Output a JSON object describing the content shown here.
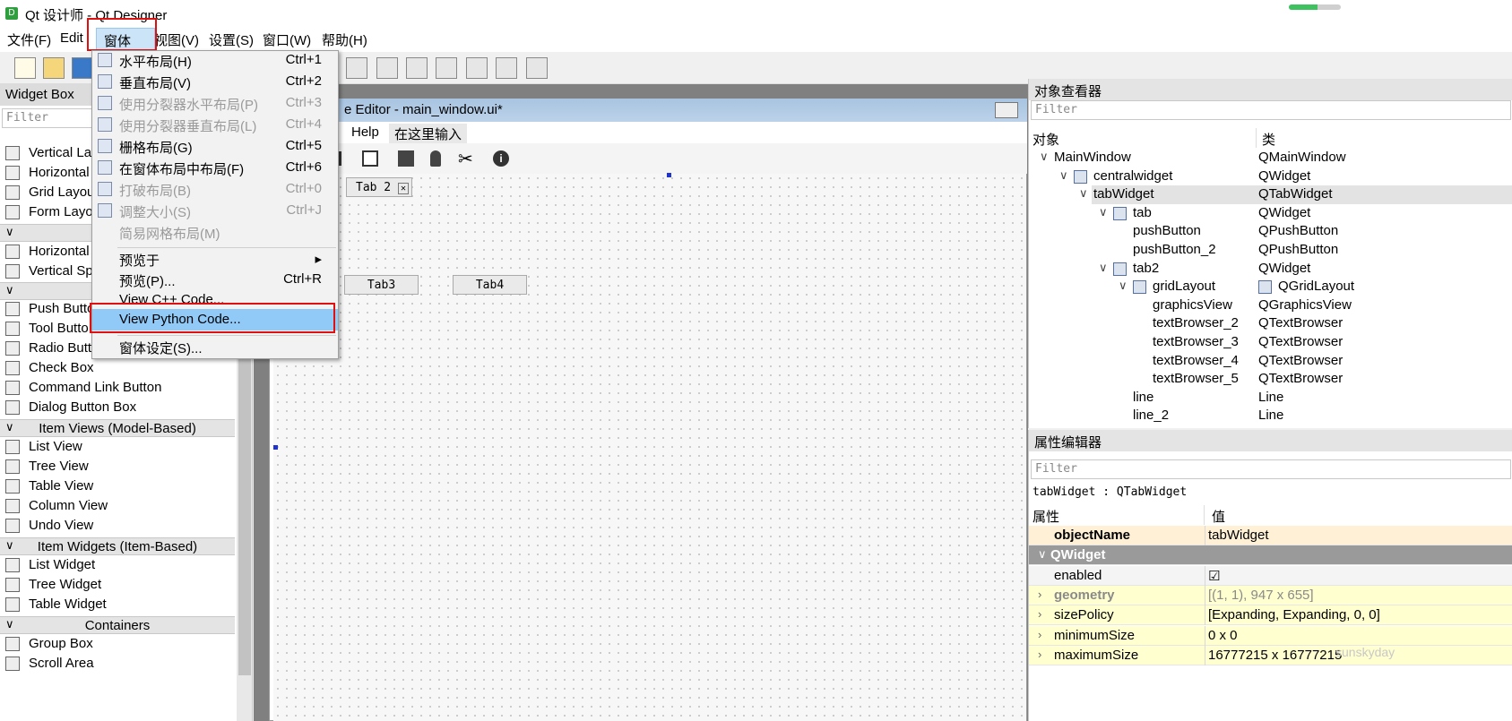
{
  "window": {
    "title": "Qt 设计师 - Qt Designer",
    "app_icon": "D"
  },
  "title_progress_fraction": 0.55,
  "menubar": [
    "文件(F)",
    "Edit",
    "窗体(O)",
    "视图(V)",
    "设置(S)",
    "窗口(W)",
    "帮助(H)"
  ],
  "popup_menu": [
    {
      "label": "水平布局(H)",
      "shortcut": "Ctrl+1",
      "disabled": false,
      "icon": "horizontal-layout-icon"
    },
    {
      "label": "垂直布局(V)",
      "shortcut": "Ctrl+2",
      "disabled": false,
      "icon": "vertical-layout-icon"
    },
    {
      "label": "使用分裂器水平布局(P)",
      "shortcut": "Ctrl+3",
      "disabled": true,
      "icon": "splitter-horizontal-icon"
    },
    {
      "label": "使用分裂器垂直布局(L)",
      "shortcut": "Ctrl+4",
      "disabled": true,
      "icon": "splitter-vertical-icon"
    },
    {
      "label": "栅格布局(G)",
      "shortcut": "Ctrl+5",
      "disabled": false,
      "icon": "grid-layout-icon"
    },
    {
      "label": "在窗体布局中布局(F)",
      "shortcut": "Ctrl+6",
      "disabled": false,
      "icon": "form-layout-icon"
    },
    {
      "label": "打破布局(B)",
      "shortcut": "Ctrl+0",
      "disabled": true,
      "icon": "break-layout-icon"
    },
    {
      "label": "调整大小(S)",
      "shortcut": "Ctrl+J",
      "disabled": true,
      "icon": "adjust-size-icon"
    },
    {
      "label": "简易网格布局(M)",
      "shortcut": "",
      "disabled": true,
      "icon": ""
    },
    {
      "label": "预览于",
      "shortcut": "▸",
      "disabled": false,
      "icon": ""
    },
    {
      "label": "预览(P)...",
      "shortcut": "Ctrl+R",
      "disabled": false,
      "icon": ""
    },
    {
      "label": "View C++ Code...",
      "shortcut": "",
      "disabled": false,
      "icon": ""
    },
    {
      "label": "View Python Code...",
      "shortcut": "",
      "disabled": false,
      "icon": ""
    },
    {
      "label": "窗体设定(S)...",
      "shortcut": "",
      "disabled": false,
      "icon": ""
    }
  ],
  "widget_box": {
    "header": "Widget Box",
    "filter_placeholder": "Filter",
    "items": [
      {
        "kind": "item",
        "label": "Vertical La",
        "icon": "vertical-layout-icon"
      },
      {
        "kind": "item",
        "label": "Horizontal",
        "icon": "horizontal-layout-icon"
      },
      {
        "kind": "item",
        "label": "Grid Layou",
        "icon": "grid-layout-icon"
      },
      {
        "kind": "item",
        "label": "Form Layo",
        "icon": "form-layout-icon"
      },
      {
        "kind": "cat",
        "label": ""
      },
      {
        "kind": "item",
        "label": "Horizontal",
        "icon": "horizontal-spacer-icon"
      },
      {
        "kind": "item",
        "label": "Vertical Sp",
        "icon": "vertical-spacer-icon"
      },
      {
        "kind": "cat",
        "label": ""
      },
      {
        "kind": "item",
        "label": "Push Butto",
        "icon": "push-button-icon"
      },
      {
        "kind": "item",
        "label": "Tool Butto",
        "icon": "tool-button-icon"
      },
      {
        "kind": "item",
        "label": "Radio Butt",
        "icon": "radio-button-icon"
      },
      {
        "kind": "item",
        "label": "Check Box",
        "icon": "check-box-icon"
      },
      {
        "kind": "item",
        "label": "Command Link Button",
        "icon": "command-link-icon"
      },
      {
        "kind": "item",
        "label": "Dialog Button Box",
        "icon": "dialog-button-box-icon"
      },
      {
        "kind": "cat",
        "label": "Item Views (Model-Based)"
      },
      {
        "kind": "item",
        "label": "List View",
        "icon": "list-view-icon"
      },
      {
        "kind": "item",
        "label": "Tree View",
        "icon": "tree-view-icon"
      },
      {
        "kind": "item",
        "label": "Table View",
        "icon": "table-view-icon"
      },
      {
        "kind": "item",
        "label": "Column View",
        "icon": "column-view-icon"
      },
      {
        "kind": "item",
        "label": "Undo View",
        "icon": "undo-view-icon"
      },
      {
        "kind": "cat",
        "label": "Item Widgets (Item-Based)"
      },
      {
        "kind": "item",
        "label": "List Widget",
        "icon": "list-widget-icon"
      },
      {
        "kind": "item",
        "label": "Tree Widget",
        "icon": "tree-widget-icon"
      },
      {
        "kind": "item",
        "label": "Table Widget",
        "icon": "table-widget-icon"
      },
      {
        "kind": "cat",
        "label": "Containers"
      },
      {
        "kind": "item",
        "label": "Group Box",
        "icon": "group-box-icon"
      },
      {
        "kind": "item",
        "label": "Scroll Area",
        "icon": "scroll-area-icon"
      }
    ]
  },
  "form": {
    "title": "e Editor - main_window.ui*",
    "menu": [
      "Help",
      "在这里输入"
    ],
    "tabs": [
      "Tab 2",
      "Tab3",
      "Tab4"
    ]
  },
  "object_inspector": {
    "header": "对象查看器",
    "filter_placeholder": "Filter",
    "col_object": "对象",
    "col_class": "类",
    "rows": [
      {
        "name": "MainWindow",
        "cls": "QMainWindow",
        "depth": 0,
        "arrow": "∨",
        "icon": "",
        "sel": false
      },
      {
        "name": "centralwidget",
        "cls": "QWidget",
        "depth": 1,
        "arrow": "∨",
        "icon": "vertical-layout-icon",
        "sel": false
      },
      {
        "name": "tabWidget",
        "cls": "QTabWidget",
        "depth": 2,
        "arrow": "∨",
        "icon": "",
        "sel": true
      },
      {
        "name": "tab",
        "cls": "QWidget",
        "depth": 3,
        "arrow": "∨",
        "icon": "broken-layout-icon",
        "sel": false
      },
      {
        "name": "pushButton",
        "cls": "QPushButton",
        "depth": 4,
        "arrow": "",
        "icon": "",
        "sel": false
      },
      {
        "name": "pushButton_2",
        "cls": "QPushButton",
        "depth": 4,
        "arrow": "",
        "icon": "",
        "sel": false
      },
      {
        "name": "tab2",
        "cls": "QWidget",
        "depth": 3,
        "arrow": "∨",
        "icon": "horizontal-layout-icon",
        "sel": false
      },
      {
        "name": "gridLayout",
        "cls": "QGridLayout",
        "depth": 4,
        "arrow": "∨",
        "icon": "grid-layout-icon",
        "sel": false
      },
      {
        "name": "graphicsView",
        "cls": "QGraphicsView",
        "depth": 5,
        "arrow": "",
        "icon": "",
        "sel": false
      },
      {
        "name": "textBrowser_2",
        "cls": "QTextBrowser",
        "depth": 5,
        "arrow": "",
        "icon": "",
        "sel": false
      },
      {
        "name": "textBrowser_3",
        "cls": "QTextBrowser",
        "depth": 5,
        "arrow": "",
        "icon": "",
        "sel": false
      },
      {
        "name": "textBrowser_4",
        "cls": "QTextBrowser",
        "depth": 5,
        "arrow": "",
        "icon": "",
        "sel": false
      },
      {
        "name": "textBrowser_5",
        "cls": "QTextBrowser",
        "depth": 5,
        "arrow": "",
        "icon": "",
        "sel": false
      },
      {
        "name": "line",
        "cls": "Line",
        "depth": 4,
        "arrow": "",
        "icon": "",
        "sel": false
      },
      {
        "name": "line_2",
        "cls": "Line",
        "depth": 4,
        "arrow": "",
        "icon": "",
        "sel": false
      }
    ]
  },
  "property_editor": {
    "header": "属性编辑器",
    "filter_placeholder": "Filter",
    "context": "tabWidget : QTabWidget",
    "col_prop": "属性",
    "col_value": "值",
    "rows": [
      {
        "name": "objectName",
        "value": "tabWidget",
        "style": "obj"
      },
      {
        "name": "QWidget",
        "value": "",
        "style": "group"
      },
      {
        "name": "enabled",
        "value": "☑",
        "style": "plain"
      },
      {
        "name": "geometry",
        "value": "[(1, 1), 947 x 655]",
        "style": "yellow-dim"
      },
      {
        "name": "sizePolicy",
        "value": "[Expanding, Expanding, 0, 0]",
        "style": "yellow"
      },
      {
        "name": "minimumSize",
        "value": "0 x 0",
        "style": "yellow"
      },
      {
        "name": "maximumSize",
        "value": "16777215 x 16777215",
        "style": "yellow"
      }
    ]
  },
  "watermark": "sunskyday",
  "colors": {
    "highlight": "#91c9f7",
    "redbox": "#e01010",
    "selected_row": "#e3e3e3",
    "prop_yellow": "#ffffd0",
    "prop_orange": "#fff0d6",
    "group_gray": "#9a9a9a"
  }
}
